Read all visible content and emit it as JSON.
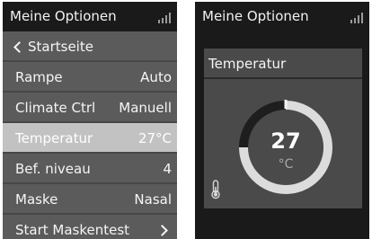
{
  "left_screen": {
    "title": "Meine Optionen",
    "signal_icon": "signal-bars-icon",
    "menu": [
      {
        "label": "Startseite",
        "value": "",
        "icon": "chevron-left-icon",
        "selected": false
      },
      {
        "label": "Rampe",
        "value": "Auto",
        "selected": false
      },
      {
        "label": "Climate Ctrl",
        "value": "Manuell",
        "selected": false
      },
      {
        "label": "Temperatur",
        "value": "27°C",
        "selected": true
      },
      {
        "label": "Bef. niveau",
        "value": "4",
        "selected": false
      },
      {
        "label": "Maske",
        "value": "Nasal",
        "selected": false
      },
      {
        "label": "Start Maskentest",
        "value": "",
        "icon": "chevron-right-icon",
        "selected": false
      }
    ]
  },
  "right_screen": {
    "title": "Meine Optionen",
    "signal_icon": "signal-bars-icon",
    "panel": {
      "title": "Temperatur",
      "value": "27",
      "unit": "°C",
      "icon": "thermometer-icon",
      "level": 0.75
    }
  },
  "colors": {
    "screen_bg": "#1a1a1a",
    "menu_row": "#5b5b5b",
    "menu_row_selected": "#c2c2c2",
    "panel_bg": "#4a4a4a",
    "gauge_fill": "#dcdcdc",
    "gauge_track": "#1e1e1e"
  }
}
